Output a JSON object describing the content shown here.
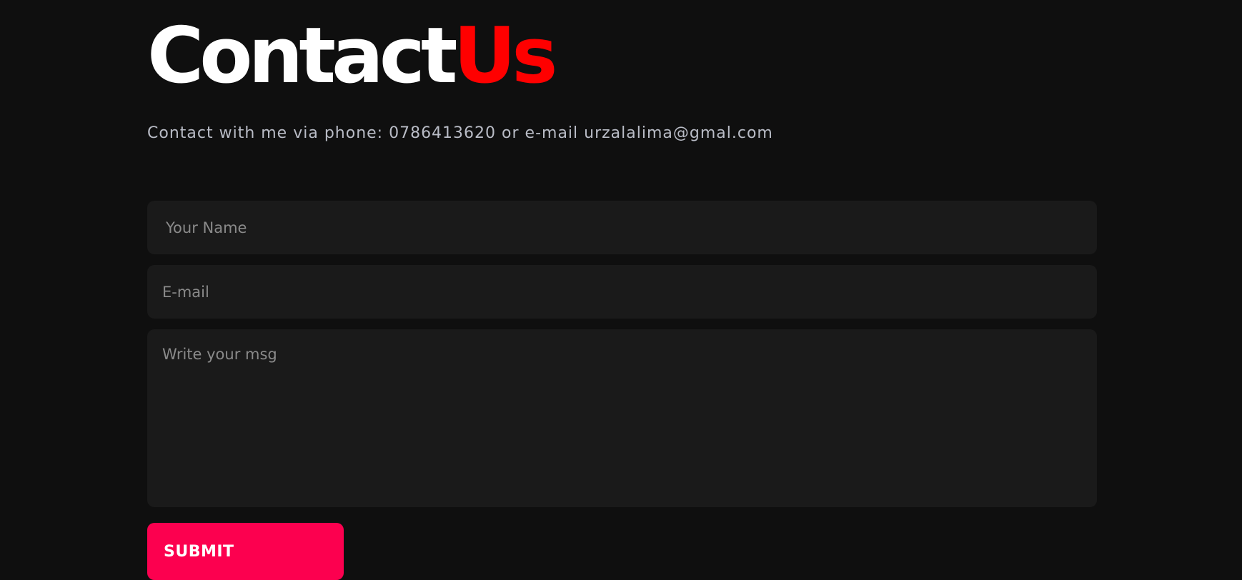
{
  "header": {
    "title_part1": "Contact",
    "title_part2": "Us",
    "subtitle": "Contact with me via phone: 0786413620 or e-mail urzalalima@gmal.com"
  },
  "form": {
    "name_placeholder": "Your Name",
    "name_value": "",
    "email_placeholder": "E-mail",
    "email_value": "",
    "message_placeholder": "Write your msg",
    "message_value": "",
    "submit_label": "SUBMIT"
  },
  "colors": {
    "background": "#0f0f0f",
    "title_primary": "#ffffff",
    "title_accent": "#ff0000",
    "field_background": "#1a1a1a",
    "submit_background": "#fc004f"
  }
}
